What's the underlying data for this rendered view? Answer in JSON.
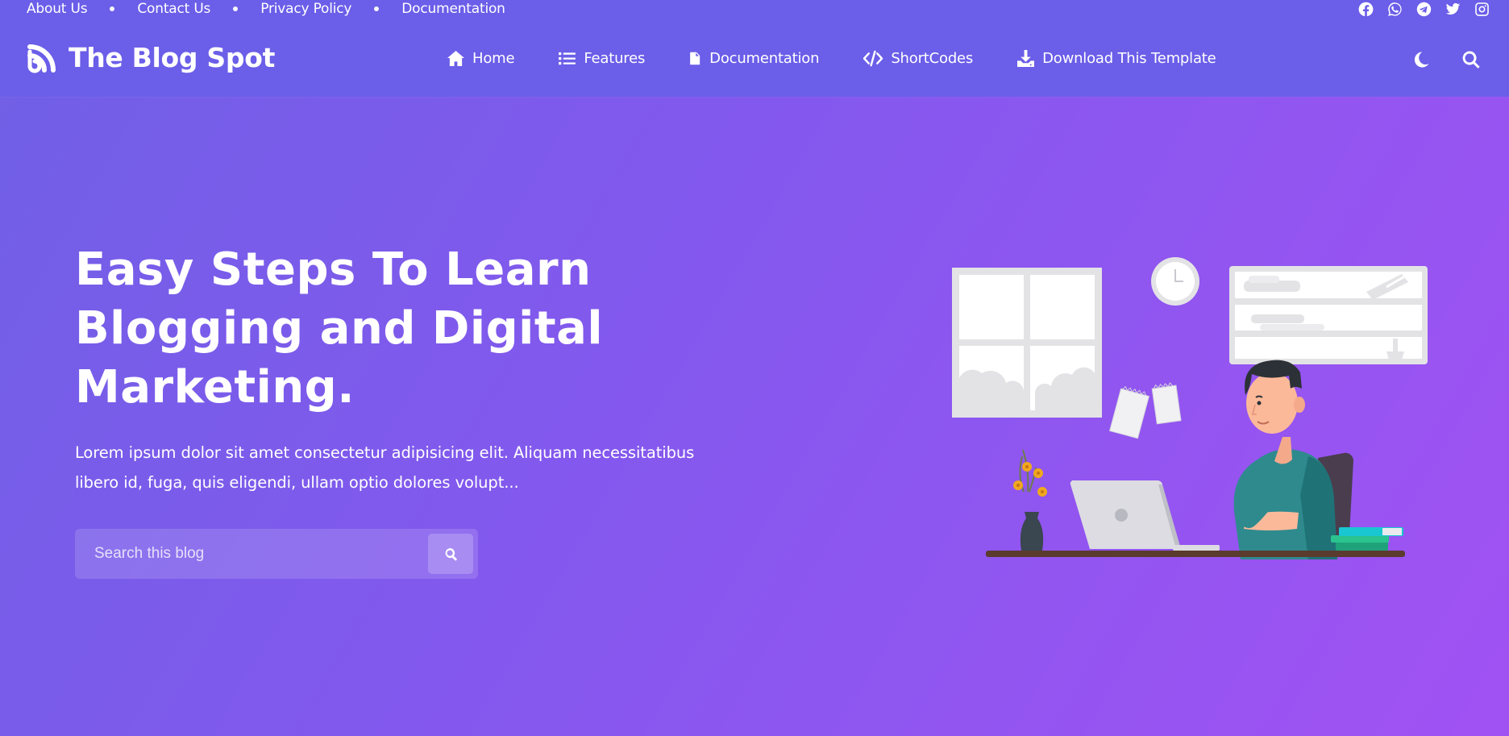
{
  "topbar": {
    "links": [
      "About Us",
      "Contact Us",
      "Privacy Policy",
      "Documentation"
    ],
    "social": [
      "facebook-icon",
      "whatsapp-icon",
      "telegram-icon",
      "twitter-icon",
      "instagram-icon"
    ]
  },
  "header": {
    "brand": "The Blog Spot",
    "nav": [
      {
        "label": "Home",
        "icon": "home-icon"
      },
      {
        "label": "Features",
        "icon": "list-icon"
      },
      {
        "label": "Documentation",
        "icon": "file-icon"
      },
      {
        "label": "ShortCodes",
        "icon": "code-icon"
      },
      {
        "label": "Download This Template",
        "icon": "download-icon"
      }
    ],
    "right_icons": [
      "moon-icon",
      "search-icon"
    ]
  },
  "hero": {
    "title_lines": [
      "Easy Steps To Learn",
      "Blogging and Digital",
      "Marketing."
    ],
    "description_lines": [
      "Lorem ipsum dolor sit amet consectetur adipisicing elit. Aliquam necessitatibus",
      "libero id, fuga, quis eligendi, ullam optio dolores volupt..."
    ],
    "search_placeholder": "Search this blog"
  },
  "colors": {
    "bar": "#6b5ee8",
    "gradient_start": "#7060e6",
    "gradient_end": "#a152f3"
  }
}
